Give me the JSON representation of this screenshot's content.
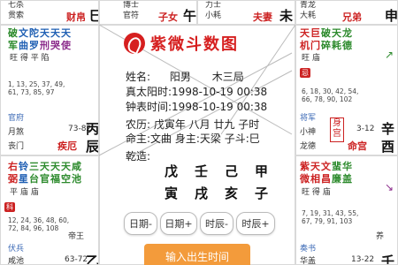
{
  "top": {
    "c1": {
      "a": "七杀",
      "b": "贯索",
      "palace": "财帛",
      "branch": "巳"
    },
    "c2": {
      "a": "博士",
      "b": "官符",
      "palace": "子女",
      "branch": "午"
    },
    "c3": {
      "a": "力士",
      "b": "小耗",
      "palace": "夫妻",
      "branch": "未"
    },
    "c4": {
      "a": "青龙",
      "b": "大耗",
      "palace": "兄弟",
      "branch": "申"
    }
  },
  "left_mid": {
    "stars1": "破文陀天天天",
    "stars2": "军曲罗刑哭使",
    "bright": "旺 得 平 陷",
    "ages": "1, 13, 25, 37, 49,\n61, 73, 85, 97",
    "god1": "官府",
    "god2": "月煞",
    "god3": "丧门",
    "range": "73-82",
    "palace": "疾厄",
    "branch": "辰",
    "stem": "丙"
  },
  "left_bottom": {
    "stars1": "右铃三天天天咸",
    "stars2": "弼星台官福空池",
    "bright": "平 庙 庙",
    "tag": "科",
    "ages": "12, 24, 36, 48, 60,\n72, 84, 96, 108",
    "god1": "伏兵",
    "god2": "咸池",
    "range": "63-72",
    "branch": "乙",
    "stem": "帝王"
  },
  "right_mid": {
    "stars1": "天巨破天龙",
    "stars2": "机门碎耗德",
    "bright": "旺 庙",
    "tag": "忌",
    "ages": "6, 18, 30, 42, 54,\n66, 78, 90, 102",
    "god1": "将军",
    "god2": "小神",
    "god3": "龙德",
    "box": "身宫",
    "range": "3-12",
    "palace": "命宫",
    "stem": "辛",
    "branch": "酉"
  },
  "right_bottom": {
    "stars1": "紫天文蜚华",
    "stars2": "微相昌廉盖",
    "bright": "旺 得 庙",
    "ages": "7, 19, 31, 43, 55,\n67, 79, 91, 103",
    "god1": "奏书",
    "god2": "华盖",
    "range": "13-22",
    "stem": "壬",
    "extra": "养"
  },
  "center": {
    "logo": "紫微斗数图",
    "name_label": "姓名:",
    "name": "阳男",
    "ju": "木三局",
    "true_time": "真太阳时:1998-10-19 00:38",
    "clock_time": "钟表时间:1998-10-19 00:38",
    "lunar": "农历: 戊寅年 八月 廿九 子时",
    "master": "命主:文曲 身主:天梁 子斗:巳",
    "ganzhi_label": "乾造:",
    "gz_top": [
      "戊",
      "壬",
      "己",
      "甲"
    ],
    "gz_bottom": [
      "寅",
      "戌",
      "亥",
      "子"
    ],
    "buttons": [
      "日期-",
      "日期+",
      "时辰-",
      "时辰+"
    ],
    "cta": "输入出生时间"
  }
}
